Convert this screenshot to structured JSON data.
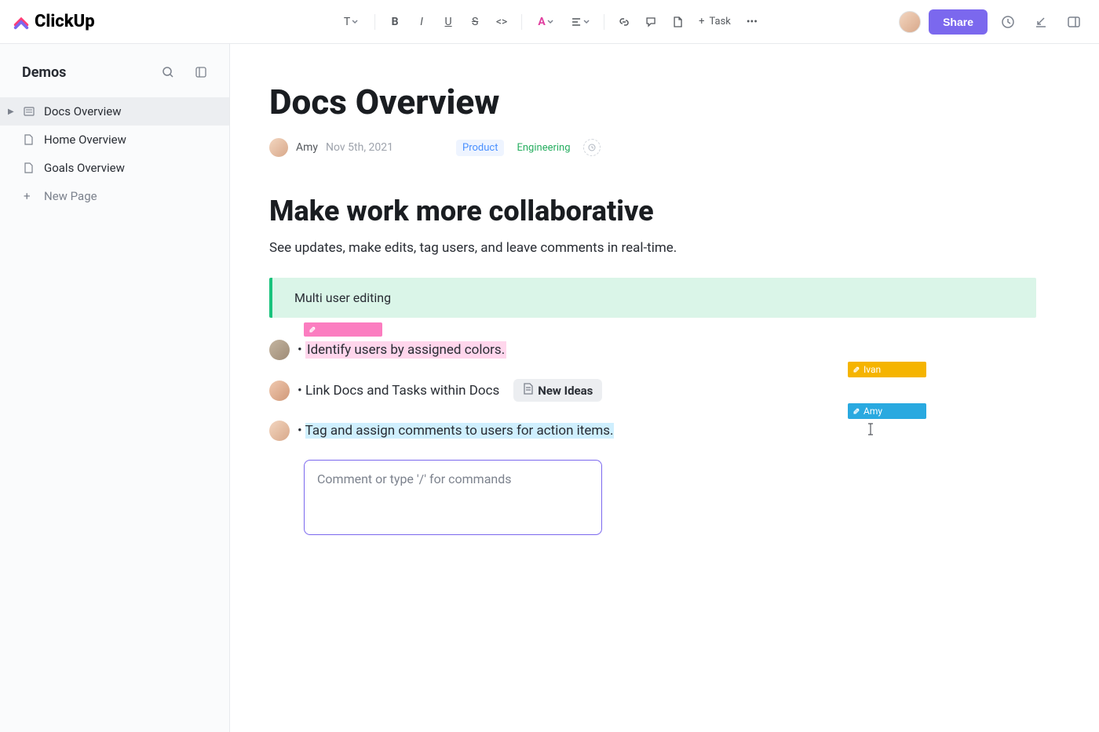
{
  "brand": {
    "name": "ClickUp"
  },
  "toolbar": {
    "share_label": "Share",
    "add_task_label": "Task"
  },
  "sidebar": {
    "title": "Demos",
    "items": [
      {
        "label": "Docs Overview",
        "active": true
      },
      {
        "label": "Home Overview",
        "active": false
      },
      {
        "label": "Goals Overview",
        "active": false
      }
    ],
    "new_page_label": "New Page"
  },
  "doc": {
    "title": "Docs Overview",
    "author": "Amy",
    "date": "Nov 5th, 2021",
    "tags": [
      {
        "label": "Product",
        "cls": "blue"
      },
      {
        "label": "Engineering",
        "cls": "green"
      }
    ],
    "heading": "Make work more collaborative",
    "lead": "See updates, make edits, tag users, and leave comments in real-time.",
    "callout": "Multi user editing",
    "bullets": [
      {
        "text": "Identify users by assigned colors."
      },
      {
        "text": "Link Docs and Tasks within Docs"
      },
      {
        "text": "Tag and assign comments to users for action items."
      }
    ],
    "chip_label": "New Ideas",
    "cursors": {
      "ivan": "Ivan",
      "amy": "Amy"
    },
    "comment_placeholder": "Comment or type '/' for commands"
  }
}
